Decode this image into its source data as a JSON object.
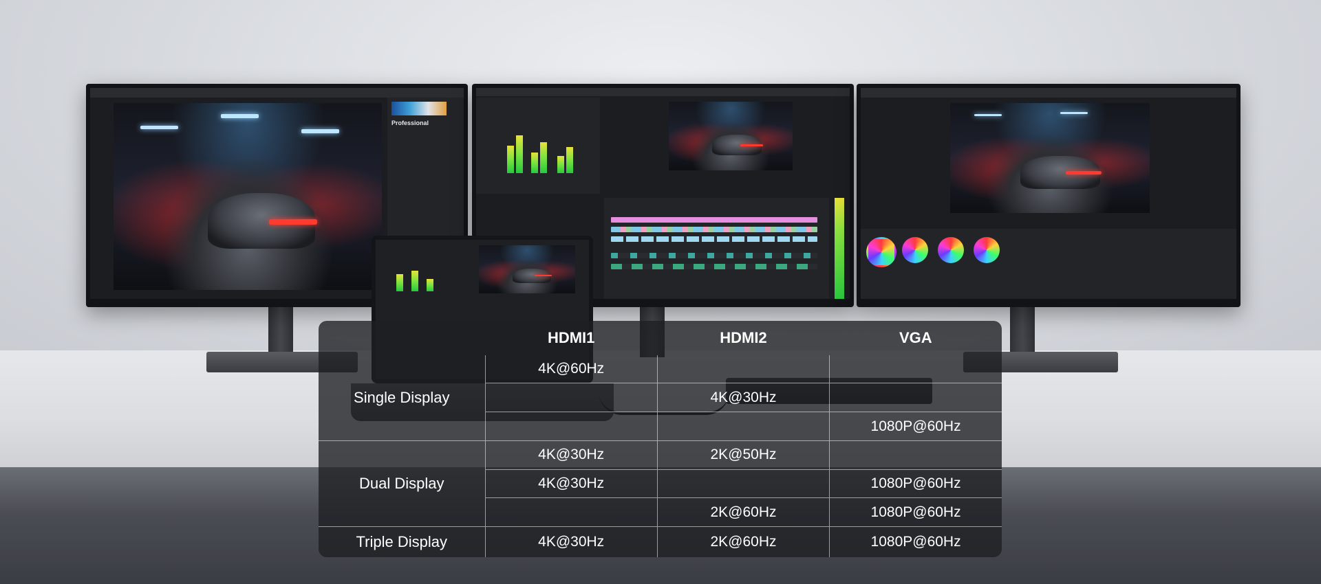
{
  "table": {
    "headers": [
      "",
      "HDMI1",
      "HDMI2",
      "VGA"
    ],
    "groups": [
      {
        "mode": "Single Display",
        "rows": [
          [
            "4K@60Hz",
            "",
            ""
          ],
          [
            "",
            "4K@30Hz",
            ""
          ],
          [
            "",
            "",
            "1080P@60Hz"
          ]
        ]
      },
      {
        "mode": "Dual Display",
        "rows": [
          [
            "4K@30Hz",
            "2K@50Hz",
            ""
          ],
          [
            "4K@30Hz",
            "",
            "1080P@60Hz"
          ],
          [
            "",
            "2K@60Hz",
            "1080P@60Hz"
          ]
        ]
      },
      {
        "mode": "Triple Display",
        "rows": [
          [
            "4K@30Hz",
            "2K@60Hz",
            "1080P@60Hz"
          ]
        ]
      }
    ]
  },
  "monitor_left": {
    "panel_title": "Professional"
  },
  "colors": {
    "table_bg": "#1e1f23",
    "text": "#ffffff",
    "grid_line": "#ffffff",
    "taillight": "#ff3b30",
    "meter_green": "#27c93f"
  }
}
